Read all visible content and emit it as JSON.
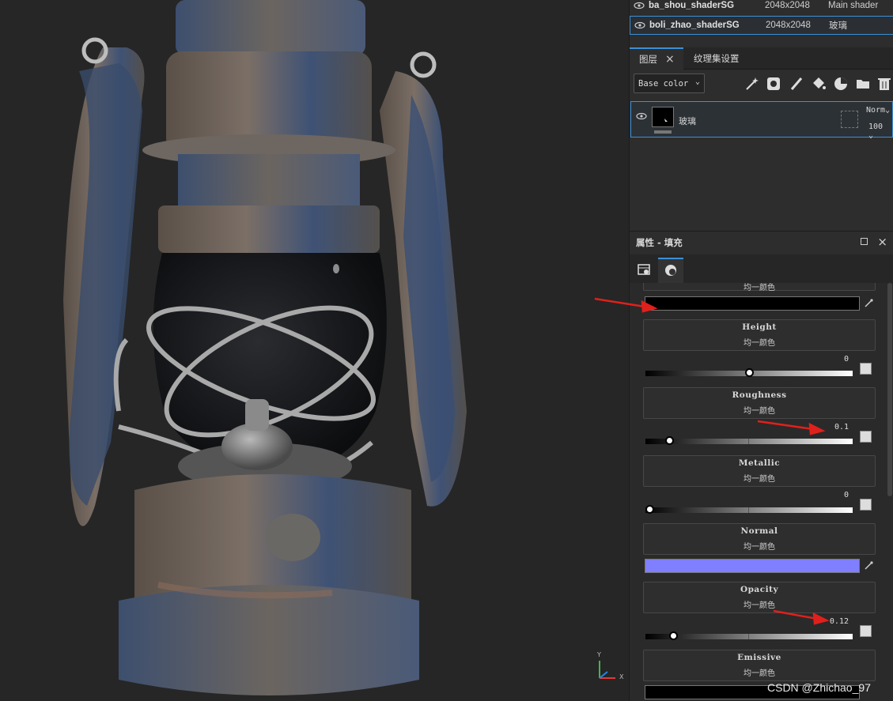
{
  "texture_sets": [
    {
      "name": "ba_shou_shaderSG",
      "size": "2048x2048",
      "shader": "Main shader"
    },
    {
      "name": "boli_zhao_shaderSG",
      "size": "2048x2048",
      "shader": "玻璃"
    }
  ],
  "layers_panel": {
    "tab_layers": "图层",
    "tab_textureset_settings": "纹理集设置",
    "channel": "Base color",
    "layer": {
      "name": "玻璃",
      "blend": "Norm",
      "opacity": "100"
    }
  },
  "properties": {
    "title": "属性 - 填充",
    "partial_label": "均一颜色",
    "channels": [
      {
        "title": "Height",
        "sub": "均一颜色",
        "value": "0",
        "level": 0.5
      },
      {
        "title": "Roughness",
        "sub": "均一颜色",
        "value": "0.1",
        "level": 0.1
      },
      {
        "title": "Metallic",
        "sub": "均一颜色",
        "value": "0",
        "level": 0.0
      },
      {
        "title": "Normal",
        "sub": "均一颜色"
      },
      {
        "title": "Opacity",
        "sub": "均一颜色",
        "value": "0.12",
        "level": 0.12
      },
      {
        "title": "Emissive",
        "sub": "均一颜色"
      }
    ],
    "colors": {
      "base_color": "#000000",
      "normal_color": "#7f7fff",
      "emissive_color": "#000000"
    }
  },
  "gizmo": {
    "y": "Y",
    "x": "X"
  },
  "watermark": "CSDN @Zhichao_97",
  "accent": "#3c8fd8"
}
